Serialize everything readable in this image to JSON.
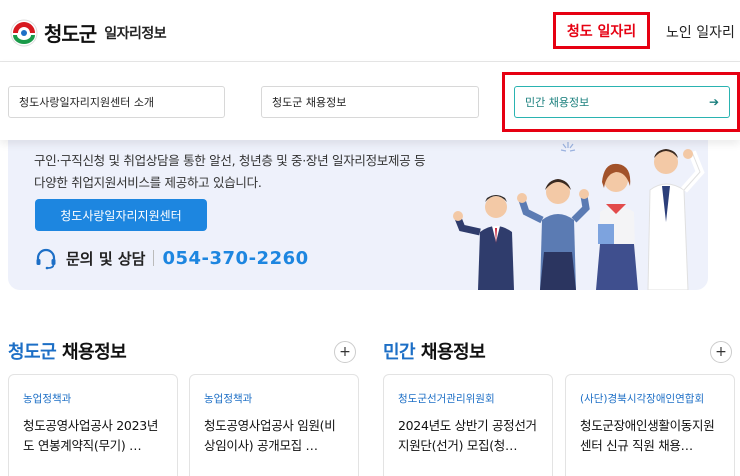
{
  "header": {
    "logo_title": "청도군",
    "logo_sub": "일자리정보",
    "nav": [
      "청도 일자리",
      "노인 일자리"
    ]
  },
  "submenu": {
    "items": [
      "청도사랑일자리지원센터 소개",
      "청도군 채용정보",
      "민간 채용정보"
    ]
  },
  "banner": {
    "line1": "구인·구직신청 및 취업상담을 통한 알선, 청년층 및 중·장년 일자리정보제공 등",
    "line2": "다양한 취업지원서비스를 제공하고 있습니다.",
    "button_label": "청도사랑일자리지원센터",
    "contact_label": "문의 및 상담",
    "phone": "054-370-2260"
  },
  "sections": [
    {
      "title_accent": "청도군",
      "title_rest": " 채용정보",
      "plus": "+",
      "cards": [
        {
          "category": "농업정책과",
          "title": "청도공영사업공사 2023년도 연봉계약직(무기) …"
        },
        {
          "category": "농업정책과",
          "title": "청도공영사업공사 임원(비상임이사) 공개모집 …"
        }
      ]
    },
    {
      "title_accent": "민간",
      "title_rest": " 채용정보",
      "plus": "+",
      "cards": [
        {
          "category": "청도군선거관리위원회",
          "title": "2024년도 상반기 공정선거지원단(선거) 모집(청…"
        },
        {
          "category": "(사단)경북시각장애인연합회",
          "title": "청도군장애인생활이동지원센터 신규 직원 채용…"
        }
      ]
    }
  ],
  "colors": {
    "highlight_red": "#e60012",
    "accent_blue": "#1d86e0",
    "teal": "#2ab3b1"
  },
  "icons": [
    "logo-emblem-icon",
    "arrow-right-icon",
    "headset-icon",
    "plus-icon"
  ]
}
